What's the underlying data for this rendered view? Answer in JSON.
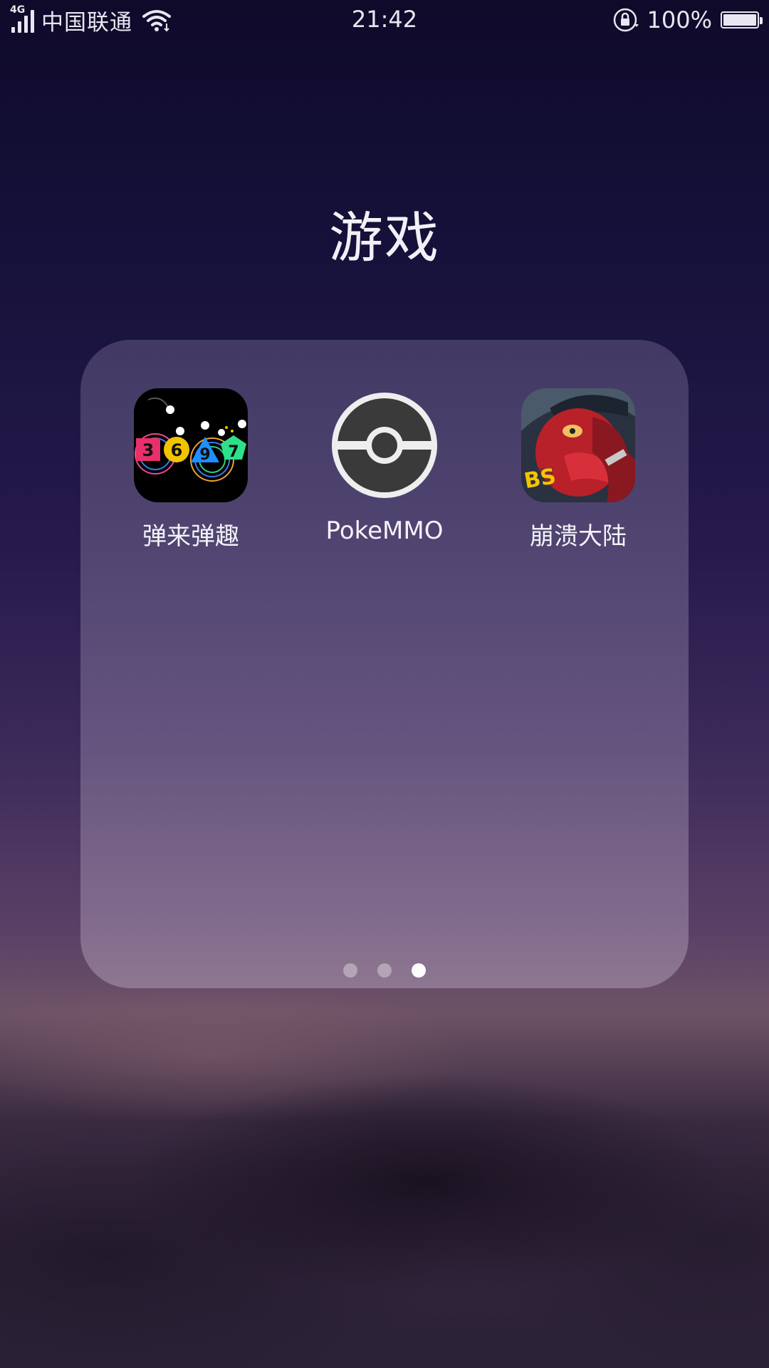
{
  "status_bar": {
    "network": "4G",
    "carrier": "中国联通",
    "time": "21:42",
    "battery_percent": "100%",
    "battery_level": 1.0,
    "icons": [
      "signal-icon",
      "wifi-icon",
      "rotation-lock-icon",
      "battery-icon"
    ]
  },
  "folder": {
    "title": "游戏",
    "apps": [
      {
        "label": "弹来弹趣",
        "icon": "ball-game-icon"
      },
      {
        "label": "PokeMMO",
        "icon": "pokeball-icon"
      },
      {
        "label": "崩溃大陆",
        "icon": "crashlands-icon"
      }
    ],
    "pages": 3,
    "current_page": 3
  },
  "icon_text": {
    "ball_numbers": [
      "3",
      "6",
      "9",
      "7"
    ],
    "bs_badge": "BS"
  }
}
